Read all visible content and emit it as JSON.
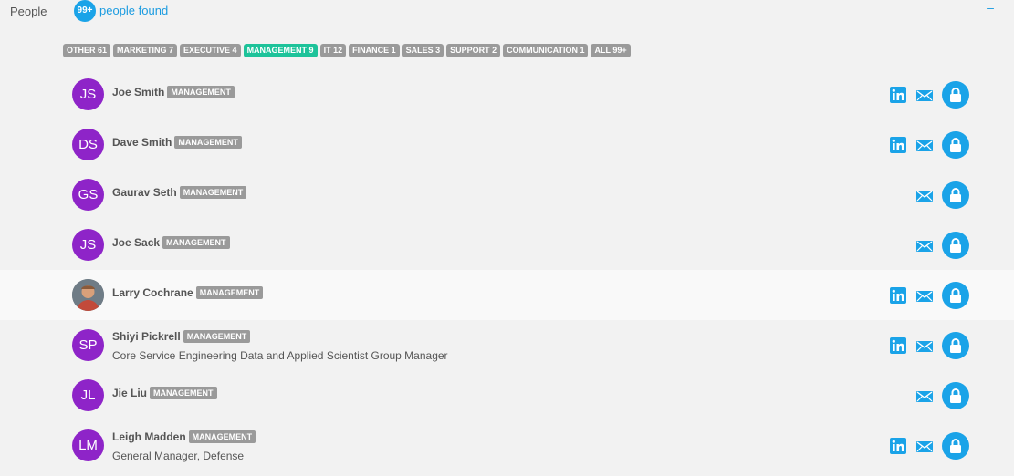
{
  "header": {
    "section_label": "People",
    "count_badge": "99+",
    "found_text": "people found",
    "collapse_symbol": "–"
  },
  "filters": [
    {
      "label": "OTHER 61",
      "active": false
    },
    {
      "label": "MARKETING 7",
      "active": false
    },
    {
      "label": "EXECUTIVE 4",
      "active": false
    },
    {
      "label": "MANAGEMENT 9",
      "active": true
    },
    {
      "label": "IT 12",
      "active": false
    },
    {
      "label": "FINANCE 1",
      "active": false
    },
    {
      "label": "SALES 3",
      "active": false
    },
    {
      "label": "SUPPORT 2",
      "active": false
    },
    {
      "label": "COMMUNICATION 1",
      "active": false
    },
    {
      "label": "ALL 99+",
      "active": false
    }
  ],
  "people": [
    {
      "initials": "JS",
      "name": "Joe Smith",
      "tag": "MANAGEMENT",
      "title": "",
      "has_linkedin": true,
      "photo": false
    },
    {
      "initials": "DS",
      "name": "Dave Smith",
      "tag": "MANAGEMENT",
      "title": "",
      "has_linkedin": true,
      "photo": false
    },
    {
      "initials": "GS",
      "name": "Gaurav Seth",
      "tag": "MANAGEMENT",
      "title": "",
      "has_linkedin": false,
      "photo": false
    },
    {
      "initials": "JS",
      "name": "Joe Sack",
      "tag": "MANAGEMENT",
      "title": "",
      "has_linkedin": false,
      "photo": false
    },
    {
      "initials": "",
      "name": "Larry Cochrane",
      "tag": "MANAGEMENT",
      "title": "",
      "has_linkedin": true,
      "photo": true
    },
    {
      "initials": "SP",
      "name": "Shiyi Pickrell",
      "tag": "MANAGEMENT",
      "title": "Core Service Engineering Data and Applied Scientist Group Manager",
      "has_linkedin": true,
      "photo": false
    },
    {
      "initials": "JL",
      "name": "Jie Liu",
      "tag": "MANAGEMENT",
      "title": "",
      "has_linkedin": false,
      "photo": false
    },
    {
      "initials": "LM",
      "name": "Leigh Madden",
      "tag": "MANAGEMENT",
      "title": "General Manager, Defense",
      "has_linkedin": true,
      "photo": false
    }
  ],
  "icons": {
    "linkedin": "linkedin-icon",
    "mail": "mail-icon",
    "lock": "lock-icon"
  },
  "colors": {
    "accent": "#1aa3e8",
    "avatar": "#8e24c8",
    "active_filter": "#1dc39a",
    "tag": "#9a9a9a"
  }
}
